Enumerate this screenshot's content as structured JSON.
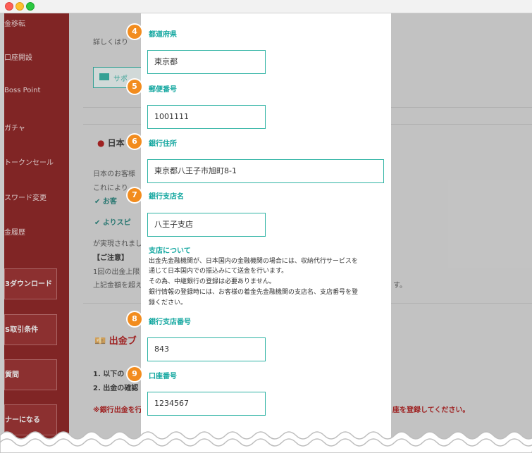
{
  "sidebar": {
    "items": [
      {
        "label": "金移転"
      },
      {
        "label": "口座開設"
      },
      {
        "label": "Boss Point"
      },
      {
        "label": "ガチャ"
      },
      {
        "label": "トークンセール"
      },
      {
        "label": "スワード変更"
      },
      {
        "label": "金履歴"
      }
    ],
    "buttons": [
      {
        "label": "3ダウンロード"
      },
      {
        "label": "S取引条件"
      },
      {
        "label": "質問"
      },
      {
        "label": "ナーになる"
      }
    ]
  },
  "background": {
    "details": "詳しくはり",
    "support_button": "サポ",
    "section_title": "日本",
    "intro_line1": "日本のお客様",
    "intro_line2": "これにより",
    "check1": "お客",
    "check2": "よりスピ",
    "realized": "が実現されまし",
    "caution": "【ご注意】",
    "caution_line1": "1回の出金上限",
    "caution_line2": "上記金額を超え",
    "caution_tail": "す。",
    "withdraw_title": "出金ブ",
    "step_a": "1. 以下の",
    "step_b": "2. 出金の確認",
    "red_warning_left": "※銀行出金を行",
    "red_warning_right": "座を登録してください。"
  },
  "form": {
    "prefecture": {
      "step": "4",
      "label": "都道府県",
      "value": "東京都"
    },
    "postal_code": {
      "step": "5",
      "label": "郵便番号",
      "value": "1001111"
    },
    "bank_address": {
      "step": "6",
      "label": "銀行住所",
      "value": "東京都八王子市旭町8-1"
    },
    "branch_name": {
      "step": "7",
      "label": "銀行支店名",
      "value": "八王子支店"
    },
    "branch_note": {
      "title": "支店について",
      "lines": [
        "出金先金融機関が、日本国内の金融機関の場合には、収納代行サービスを",
        "通じて日本国内での振込みにて送金を行います。",
        "その為、中継銀行の登録は必要ありません。",
        "銀行情報の登録時には、お客様の着金先金融機関の支店名、支店番号を登",
        "録ください。"
      ]
    },
    "branch_number": {
      "step": "8",
      "label": "銀行支店番号",
      "value": "843"
    },
    "account_number": {
      "step": "9",
      "label": "口座番号",
      "value": "1234567"
    }
  }
}
